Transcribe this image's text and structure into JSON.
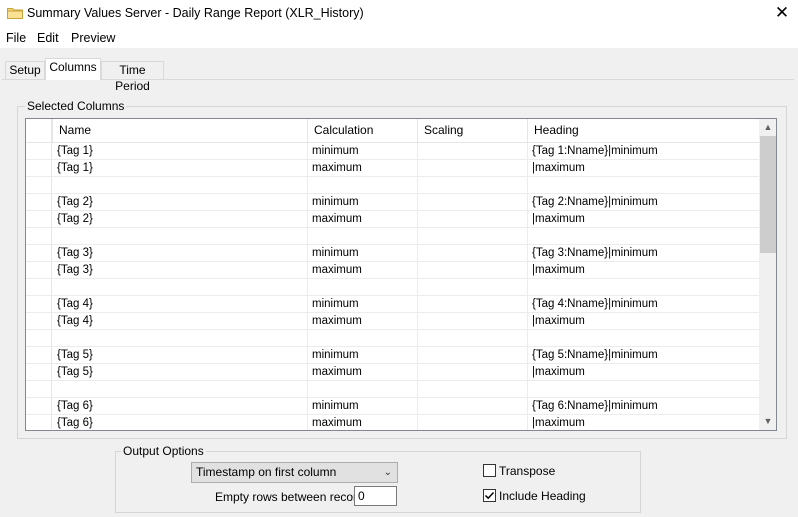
{
  "window": {
    "title": "Summary Values Server - Daily Range Report (XLR_History)",
    "close_glyph": "✕"
  },
  "menu": [
    "File",
    "Edit",
    "Preview"
  ],
  "tabs": [
    {
      "label": "Setup",
      "active": false
    },
    {
      "label": "Columns",
      "active": true
    },
    {
      "label": "Time Period",
      "active": false
    }
  ],
  "selected_columns": {
    "group_label": "Selected Columns",
    "headers": [
      "Name",
      "Calculation",
      "Scaling",
      "Heading"
    ],
    "rows": [
      {
        "name": "{Tag 1}",
        "calculation": "minimum",
        "scaling": "",
        "heading": "{Tag 1:Nname}|minimum"
      },
      {
        "name": "{Tag 1}",
        "calculation": "maximum",
        "scaling": "",
        "heading": "|maximum"
      },
      {
        "name": "",
        "calculation": "",
        "scaling": "",
        "heading": ""
      },
      {
        "name": "{Tag 2}",
        "calculation": "minimum",
        "scaling": "",
        "heading": "{Tag 2:Nname}|minimum"
      },
      {
        "name": "{Tag 2}",
        "calculation": "maximum",
        "scaling": "",
        "heading": "|maximum"
      },
      {
        "name": "",
        "calculation": "",
        "scaling": "",
        "heading": ""
      },
      {
        "name": "{Tag 3}",
        "calculation": "minimum",
        "scaling": "",
        "heading": "{Tag 3:Nname}|minimum"
      },
      {
        "name": "{Tag 3}",
        "calculation": "maximum",
        "scaling": "",
        "heading": "|maximum"
      },
      {
        "name": "",
        "calculation": "",
        "scaling": "",
        "heading": ""
      },
      {
        "name": "{Tag 4}",
        "calculation": "minimum",
        "scaling": "",
        "heading": "{Tag 4:Nname}|minimum"
      },
      {
        "name": "{Tag 4}",
        "calculation": "maximum",
        "scaling": "",
        "heading": "|maximum"
      },
      {
        "name": "",
        "calculation": "",
        "scaling": "",
        "heading": ""
      },
      {
        "name": "{Tag 5}",
        "calculation": "minimum",
        "scaling": "",
        "heading": "{Tag 5:Nname}|minimum"
      },
      {
        "name": "{Tag 5}",
        "calculation": "maximum",
        "scaling": "",
        "heading": "|maximum"
      },
      {
        "name": "",
        "calculation": "",
        "scaling": "",
        "heading": ""
      },
      {
        "name": "{Tag 6}",
        "calculation": "minimum",
        "scaling": "",
        "heading": "{Tag 6:Nname}|minimum"
      },
      {
        "name": "{Tag 6}",
        "calculation": "maximum",
        "scaling": "",
        "heading": "|maximum"
      }
    ]
  },
  "output_options": {
    "group_label": "Output Options",
    "timestamp_select": "Timestamp on first column",
    "empty_rows_label": "Empty rows between records",
    "empty_rows_value": "0",
    "transpose": {
      "label": "Transpose",
      "checked": false
    },
    "include_heading": {
      "label": "Include Heading",
      "checked": true
    }
  }
}
